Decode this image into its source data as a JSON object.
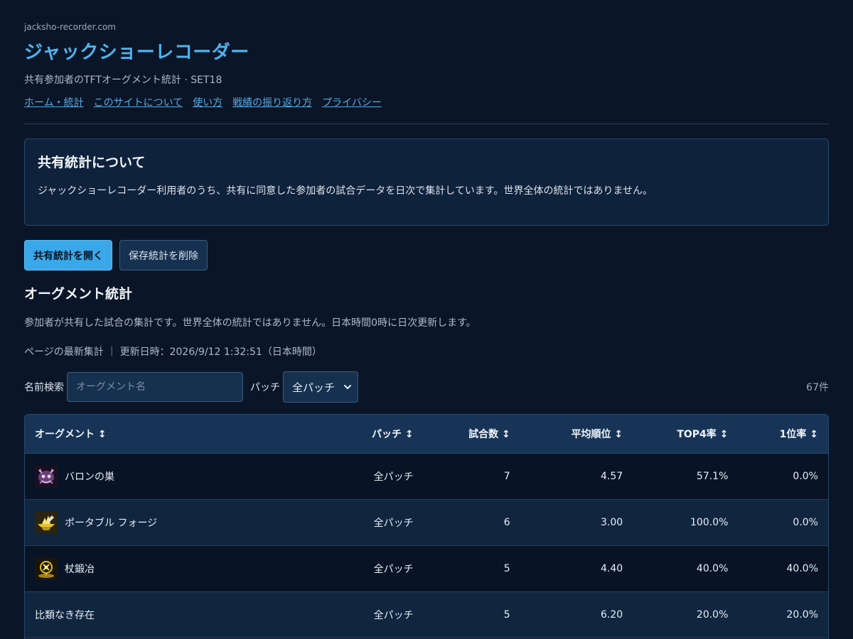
{
  "header": {
    "domain": "jacksho-recorder.com",
    "title": "ジャックショーレコーダー",
    "subtitle": "共有参加者のTFTオーグメント統計 · SET18",
    "nav": [
      {
        "label": "ホーム・統計"
      },
      {
        "label": "このサイトについて"
      },
      {
        "label": "使い方"
      },
      {
        "label": "戦績の振り返り方"
      },
      {
        "label": "プライバシー"
      }
    ]
  },
  "info_card": {
    "title": "共有統計について",
    "body": "ジャックショーレコーダー利用者のうち、共有に同意した参加者の試合データを日次で集計しています。世界全体の統計ではありません。"
  },
  "buttons": {
    "open_label": "共有統計を開く",
    "delete_label": "保存統計を削除"
  },
  "section": {
    "title": "オーグメント統計",
    "description": "参加者が共有した試合の集計です。世界全体の統計ではありません。日本時間0時に日次更新します。",
    "updated": "ページの最新集計 ｜ 更新日時：2026/9/12 1:32:51（日本時間）"
  },
  "filters": {
    "search_label": "名前検索",
    "search_placeholder": "オーグメント名",
    "search_value": "",
    "patch_label": "パッチ",
    "patch_selected": "全パッチ",
    "count": "67件"
  },
  "table": {
    "columns": [
      {
        "label": "オーグメント ↕"
      },
      {
        "label": "パッチ ↕"
      },
      {
        "label": "試合数 ↕"
      },
      {
        "label": "平均順位 ↕"
      },
      {
        "label": "TOP4率 ↕"
      },
      {
        "label": "1位率 ↕"
      }
    ],
    "rows": [
      {
        "name": "バロンの巣",
        "icon": "baron-nest-icon",
        "patch": "全パッチ",
        "games": "7",
        "avg": "4.57",
        "top4": "57.1%",
        "first": "0.0%"
      },
      {
        "name": "ポータブル フォージ",
        "icon": "portable-forge-icon",
        "patch": "全パッチ",
        "games": "6",
        "avg": "3.00",
        "top4": "100.0%",
        "first": "0.0%"
      },
      {
        "name": "杖鍛冶",
        "icon": "staff-smith-icon",
        "patch": "全パッチ",
        "games": "5",
        "avg": "4.40",
        "top4": "40.0%",
        "first": "40.0%"
      },
      {
        "name": "比類なき存在",
        "icon": "",
        "patch": "全パッチ",
        "games": "5",
        "avg": "6.20",
        "top4": "20.0%",
        "first": "20.0%"
      }
    ]
  },
  "colors": {
    "background": "#0a1628",
    "accent": "#3aa8e8",
    "title": "#4fb3ee",
    "link": "#5aa9e0"
  }
}
